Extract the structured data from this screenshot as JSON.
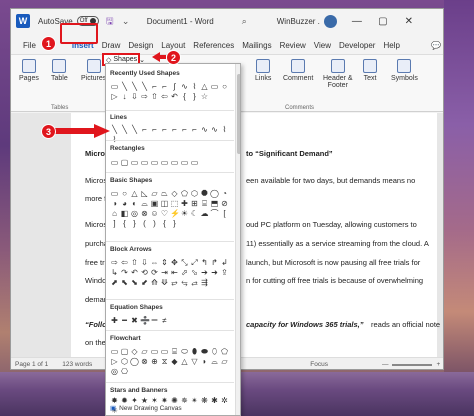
{
  "titlebar": {
    "autosave_label": "AutoSave",
    "toggle_label": "Off",
    "doc_title": "Document1 - Word",
    "user_name": "WinBuzzer .",
    "minimize": "—",
    "restore": "▢",
    "close": "✕"
  },
  "tabs": [
    "File",
    "Insert",
    "Draw",
    "Design",
    "Layout",
    "References",
    "Mailings",
    "Review",
    "View",
    "Developer",
    "Help"
  ],
  "comments_label": "💬",
  "callouts": {
    "one": "1",
    "two": "2",
    "three": "3"
  },
  "ribbon": {
    "pages": "Pages",
    "table": "Table",
    "tables_section": "Tables",
    "pictures": "Pictures",
    "shapes": "Shapes",
    "links": "Links",
    "comment": "Comment",
    "comments_section": "Comments",
    "header_footer": "Header &",
    "footer": "Footer",
    "text": "Text",
    "symbols": "Symbols"
  },
  "dropdown": {
    "recently_used": "Recently Used Shapes",
    "lines": "Lines",
    "rectangles": "Rectangles",
    "basic_shapes": "Basic Shapes",
    "block_arrows": "Block Arrows",
    "equation_shapes": "Equation Shapes",
    "flowchart": "Flowchart",
    "stars_banners": "Stars and Banners",
    "new_canvas": "New Drawing Canvas"
  },
  "document": {
    "l1a": "Microso",
    "l1b": "to “Significant Demand”",
    "l2a": "Microso",
    "l2b": "een available for two days, but demands means no",
    "l3a": "more f",
    "l4a": "Microso",
    "l4b": "oud PC platform on Tuesday, allowing customers to",
    "l5a": "purcha",
    "l5b": "11) essentially as a service streaming from the cloud. A",
    "l6a": "free tr",
    "l6b": "launch, but Microsoft is now pausing all free trials for",
    "l7a": "Windo",
    "l7b": "n for cutting off free trials is because of overwhelming",
    "l8a": "demar",
    "l9a": "“Follo",
    "l9b": "capacity for Windows 365 trials,”",
    "l9c": "reads an official note",
    "l10a": "on the"
  },
  "statusbar": {
    "page": "Page 1 of 1",
    "words": "123 words",
    "focus": "Focus",
    "zoom_minus": "—",
    "zoom_plus": "+"
  }
}
